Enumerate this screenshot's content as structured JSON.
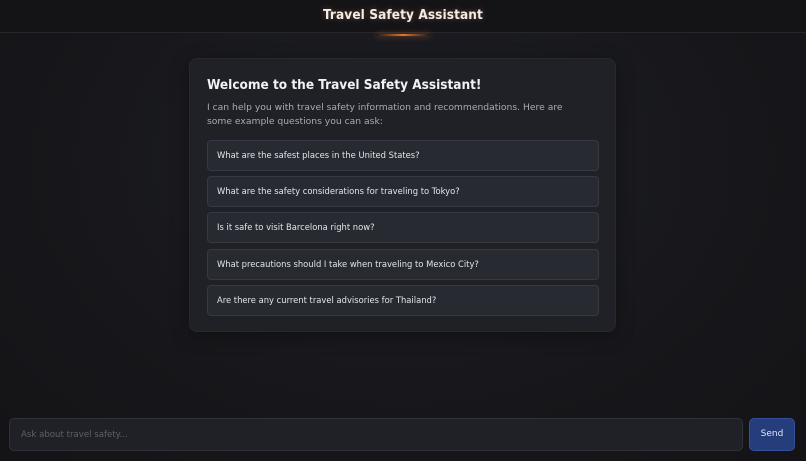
{
  "header": {
    "title": "Travel Safety Assistant"
  },
  "welcome": {
    "title": "Welcome to the Travel Safety Assistant!",
    "description": "I can help you with travel safety information and recommendations. Here are some example questions you can ask:",
    "questions": [
      "What are the safest places in the United States?",
      "What are the safety considerations for traveling to Tokyo?",
      "Is it safe to visit Barcelona right now?",
      "What precautions should I take when traveling to Mexico City?",
      "Are there any current travel advisories for Thailand?"
    ]
  },
  "chat_input": {
    "placeholder": "Ask about travel safety...",
    "value": ""
  },
  "send_button": {
    "label": "Send"
  },
  "colors": {
    "background": "#17171b",
    "card": "#1f2127",
    "question_bg": "#272a31",
    "accent_underline": "#e0752e",
    "send_button": "#263d7c"
  }
}
